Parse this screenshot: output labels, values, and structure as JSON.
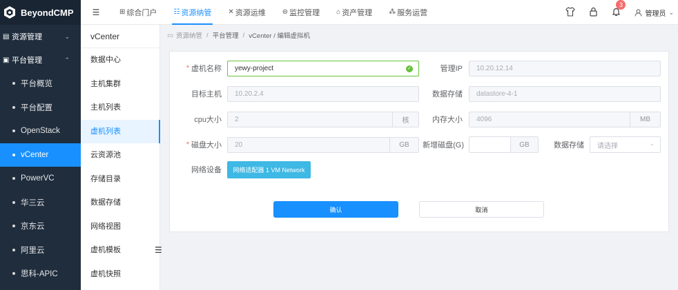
{
  "brand": {
    "name": "BeyondCMP"
  },
  "sidebar": {
    "groups": [
      {
        "label": "资源管理",
        "expanded": false
      },
      {
        "label": "平台管理",
        "expanded": true
      }
    ],
    "items": [
      {
        "label": "平台概览"
      },
      {
        "label": "平台配置"
      },
      {
        "label": "OpenStack"
      },
      {
        "label": "vCenter",
        "active": true
      },
      {
        "label": "PowerVC"
      },
      {
        "label": "华三云"
      },
      {
        "label": "京东云"
      },
      {
        "label": "阿里云"
      },
      {
        "label": "思科-APIC"
      }
    ]
  },
  "header": {
    "tabs": [
      {
        "label": "综合门户"
      },
      {
        "label": "资源纳管",
        "active": true
      },
      {
        "label": "资源运维"
      },
      {
        "label": "监控管理"
      },
      {
        "label": "资产管理"
      },
      {
        "label": "服务运营"
      }
    ],
    "notification_count": "3",
    "user": "管理员"
  },
  "submenu": {
    "title": "vCenter",
    "items": [
      {
        "label": "数据中心"
      },
      {
        "label": "主机集群"
      },
      {
        "label": "主机列表"
      },
      {
        "label": "虚机列表",
        "active": true
      },
      {
        "label": "云资源池"
      },
      {
        "label": "存储目录"
      },
      {
        "label": "数据存储"
      },
      {
        "label": "网络视图"
      },
      {
        "label": "虚机模板"
      },
      {
        "label": "虚机快照"
      }
    ]
  },
  "breadcrumb": {
    "items": [
      "资源纳管",
      "平台管理",
      "vCenter / 编辑虚拟机"
    ]
  },
  "form": {
    "vm_name_label": "虚机名称",
    "vm_name_value": "yewy-project",
    "mgmt_ip_label": "管理IP",
    "mgmt_ip_value": "10.20.12.14",
    "target_host_label": "目标主机",
    "target_host_value": "10.20.2.4",
    "datastore_label": "数据存储",
    "datastore_value": "datastore-4-1",
    "cpu_label": "cpu大小",
    "cpu_value": "2",
    "cpu_unit": "核",
    "mem_label": "内存大小",
    "mem_value": "4096",
    "mem_unit": "MB",
    "disk_label": "磁盘大小",
    "disk_value": "20",
    "disk_unit": "GB",
    "new_disk_label": "新增磁盘(G)",
    "new_disk_value": "",
    "new_disk_unit": "GB",
    "disk_store_label": "数据存储",
    "disk_store_placeholder": "请选择",
    "network_label": "网络设备",
    "network_button": "网络适配器 1 VM Network",
    "confirm": "确认",
    "cancel": "取消"
  }
}
